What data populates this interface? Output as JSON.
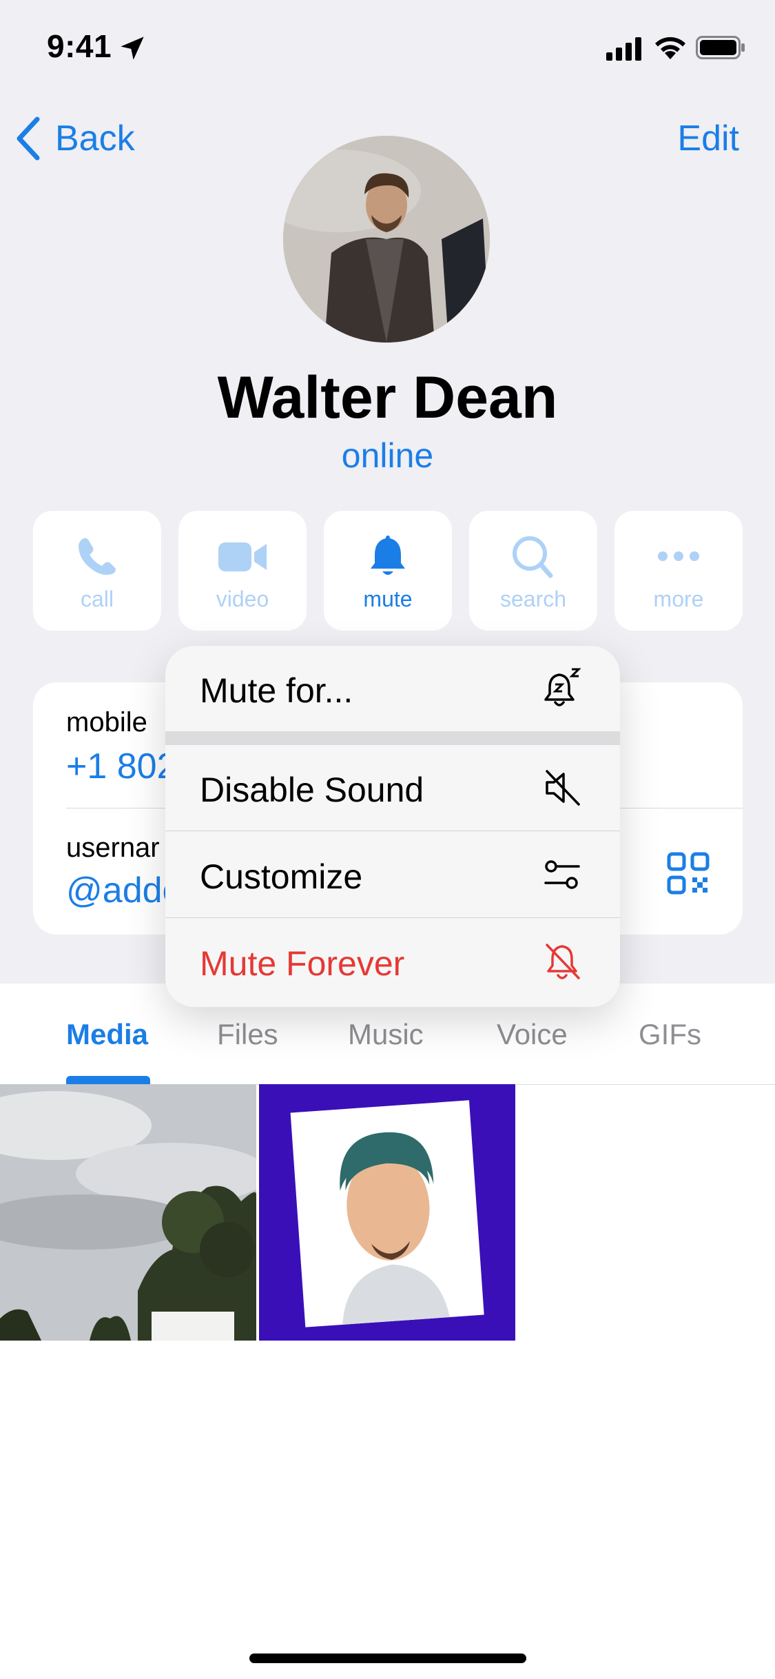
{
  "status_bar": {
    "time": "9:41"
  },
  "nav": {
    "back_label": "Back",
    "edit_label": "Edit"
  },
  "profile": {
    "name": "Walter Dean",
    "status": "online"
  },
  "actions": [
    {
      "label": "call",
      "icon": "phone-icon"
    },
    {
      "label": "video",
      "icon": "video-camera-icon"
    },
    {
      "label": "mute",
      "icon": "bell-icon"
    },
    {
      "label": "search",
      "icon": "search-icon"
    },
    {
      "label": "more",
      "icon": "more-dots-icon"
    }
  ],
  "info": {
    "mobile_label": "mobile",
    "mobile_value": "+1 802",
    "username_label": "usernar",
    "username_value": "@adde"
  },
  "mute_menu": {
    "items": [
      {
        "label": "Mute for...",
        "icon": "bell-zz-icon"
      },
      {
        "label": "Disable Sound",
        "icon": "speaker-muted-icon"
      },
      {
        "label": "Customize",
        "icon": "sliders-icon"
      },
      {
        "label": "Mute Forever",
        "icon": "bell-slash-icon",
        "danger": true
      }
    ]
  },
  "tabs": [
    "Media",
    "Files",
    "Music",
    "Voice",
    "GIFs"
  ],
  "active_tab": "Media",
  "colors": {
    "accent": "#1b7ee6",
    "danger": "#e53935",
    "background": "#efeff4"
  }
}
